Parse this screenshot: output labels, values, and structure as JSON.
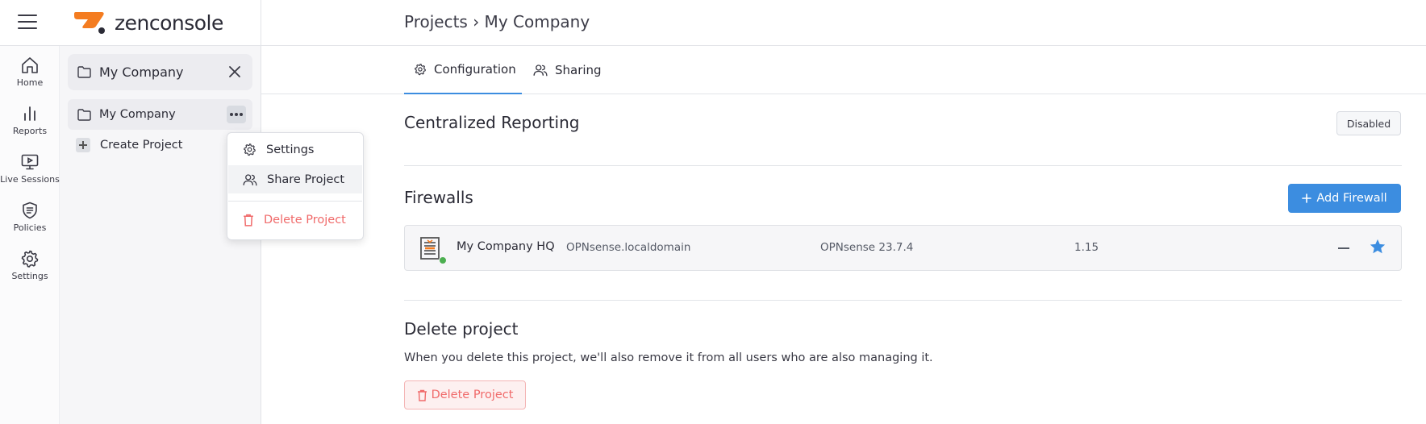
{
  "header": {
    "logo_text": "zenconsole",
    "breadcrumb": "Projects › My Company"
  },
  "rail": {
    "items": [
      {
        "label": "Home",
        "icon": "home-icon"
      },
      {
        "label": "Reports",
        "icon": "bar-chart-icon"
      },
      {
        "label": "Live Sessions",
        "icon": "monitor-play-icon"
      },
      {
        "label": "Policies",
        "icon": "shield-icon"
      },
      {
        "label": "Settings",
        "icon": "gear-icon"
      }
    ]
  },
  "project_panel": {
    "title": "My Company",
    "project_name": "My Company",
    "create_label": "Create Project"
  },
  "context_menu": {
    "items": [
      {
        "label": "Settings",
        "icon": "gear-icon"
      },
      {
        "label": "Share Project",
        "icon": "users-icon"
      },
      {
        "label": "Delete Project",
        "icon": "trash-icon"
      }
    ]
  },
  "tabs": [
    {
      "label": "Configuration",
      "icon": "gear-icon",
      "active": true
    },
    {
      "label": "Sharing",
      "icon": "users-icon",
      "active": false
    }
  ],
  "reporting": {
    "title": "Centralized Reporting",
    "status": "Disabled"
  },
  "firewalls": {
    "title": "Firewalls",
    "add_label": "Add Firewall",
    "rows": [
      {
        "name": "My Company HQ",
        "hostname": "OPNsense.localdomain",
        "os": "OPNsense 23.7.4",
        "version": "1.15",
        "online": true,
        "favorite": true
      }
    ]
  },
  "delete_section": {
    "title": "Delete project",
    "description": "When you delete this project, we'll also remove it from all users who are also managing it.",
    "button_label": "Delete Project"
  },
  "colors": {
    "accent": "#3c8de0",
    "danger": "#f06a6a",
    "logo_orange": "#f47c20",
    "online": "#4caf50"
  }
}
